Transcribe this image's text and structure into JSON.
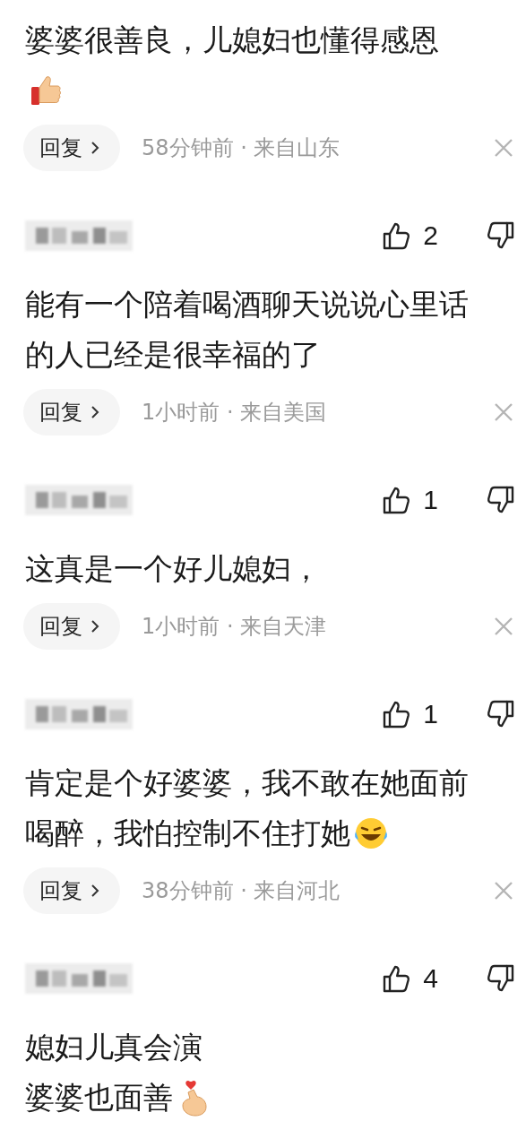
{
  "comments": [
    {
      "lines": [
        [
          {
            "kind": "text",
            "text": "婆婆很善良，儿媳妇也懂得感恩"
          }
        ],
        [
          {
            "kind": "thumbs_up"
          }
        ]
      ],
      "reply": "回复",
      "meta": "58分钟前 · 来自山东"
    },
    {
      "likes": "2",
      "lines": [
        [
          {
            "kind": "text",
            "text": "能有一个陪着喝酒聊天说说心里话"
          }
        ],
        [
          {
            "kind": "text",
            "text": "的人已经是很幸福的了"
          }
        ]
      ],
      "reply": "回复",
      "meta": "1小时前 · 来自美国"
    },
    {
      "likes": "1",
      "lines": [
        [
          {
            "kind": "text",
            "text": "这真是一个好儿媳妇，"
          }
        ]
      ],
      "reply": "回复",
      "meta": "1小时前 · 来自天津"
    },
    {
      "likes": "1",
      "lines": [
        [
          {
            "kind": "text",
            "text": "肯定是个好婆婆，我不敢在她面前"
          }
        ],
        [
          {
            "kind": "text",
            "text": "喝醉，我怕控制不住打她"
          },
          {
            "kind": "laughing"
          }
        ]
      ],
      "reply": "回复",
      "meta": "38分钟前 · 来自河北"
    },
    {
      "likes": "4",
      "lines": [
        [
          {
            "kind": "text",
            "text": "媳妇儿真会演"
          }
        ],
        [
          {
            "kind": "text",
            "text": "婆婆也面善"
          },
          {
            "kind": "finger_heart"
          }
        ]
      ]
    }
  ]
}
